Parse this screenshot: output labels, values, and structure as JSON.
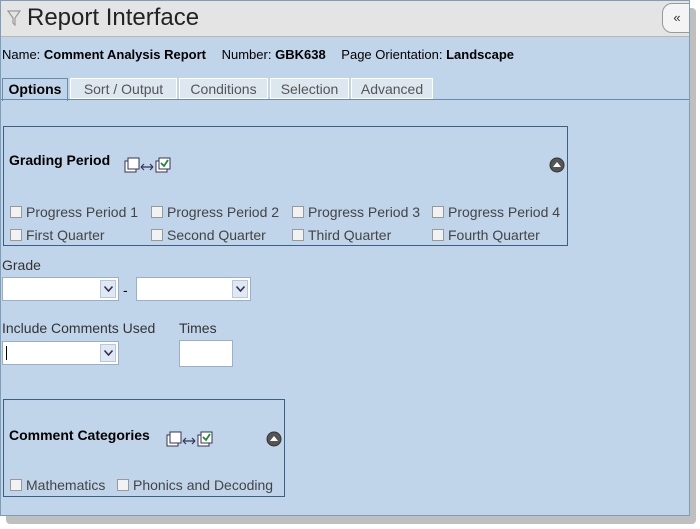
{
  "window": {
    "title": "Report Interface",
    "collapse_label": "«"
  },
  "report": {
    "name_label": "Name:",
    "name_value": "Comment Analysis Report",
    "number_label": "Number:",
    "number_value": "GBK638",
    "orientation_label": "Page Orientation:",
    "orientation_value": "Landscape"
  },
  "tabs": [
    {
      "label": "Options",
      "active": true
    },
    {
      "label": "Sort / Output",
      "active": false
    },
    {
      "label": "Conditions",
      "active": false
    },
    {
      "label": "Selection",
      "active": false
    },
    {
      "label": "Advanced",
      "active": false
    }
  ],
  "grading_period": {
    "title": "Grading Period",
    "options": [
      "Progress Period 1",
      "Progress Period 2",
      "Progress Period 3",
      "Progress Period 4",
      "First Quarter",
      "Second Quarter",
      "Third Quarter",
      "Fourth Quarter"
    ]
  },
  "grade": {
    "label": "Grade",
    "separator": "-",
    "from_value": "",
    "to_value": ""
  },
  "include_comments": {
    "label": "Include Comments Used",
    "times_label": "Times",
    "select_value": "",
    "times_value": ""
  },
  "comment_categories": {
    "title": "Comment Categories",
    "options": [
      "Mathematics",
      "Phonics and Decoding"
    ]
  }
}
